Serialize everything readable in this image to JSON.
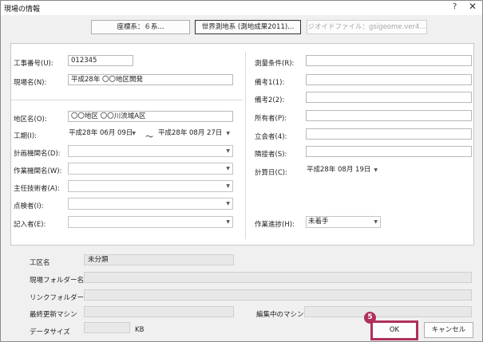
{
  "window": {
    "title": "現場の情報",
    "help": "?",
    "close": "✕"
  },
  "top_buttons": {
    "coord": "座標系：６系...",
    "datum": "世界測地系 (測地成果2011)...",
    "geoid": "ジオイドファイル：gsigeome.ver4..."
  },
  "left": {
    "koji_label": "工事番号(U):",
    "koji_value": "012345",
    "genba_label": "現場名(N):",
    "genba_value": "平成28年 〇〇地区開発",
    "chiku_label": "地区名(O):",
    "chiku_value": "〇〇地区 〇〇川流域A区",
    "kouki_label": "工期(I):",
    "kouki_from": "平成28年 06月 09日",
    "tilde": "～",
    "kouki_to": "平成28年 08月 27日",
    "keikaku_label": "計画機関名(D):",
    "sagyo_label": "作業機関名(W):",
    "shunin_label": "主任技術者(A):",
    "tenken_label": "点検者(I):",
    "kinyu_label": "記入者(E):"
  },
  "right": {
    "sokuryo_label": "測量条件(R):",
    "biko1_label": "備考1(1):",
    "biko2_label": "備考2(2):",
    "shoyu_label": "所有者(P):",
    "tachiai_label": "立会者(4):",
    "rinsetsu_label": "隣接者(S):",
    "keisan_label": "計算日(C):",
    "keisan_value": "平成28年 08月 19日",
    "shincho_label": "作業進捗(H):",
    "shincho_value": "未着手"
  },
  "info": {
    "kouku_label": "工区名",
    "kouku_value": "未分類",
    "folder_label": "現場フォルダー名",
    "link_label": "リンクフォルダー名",
    "machine_label": "最終更新マシン",
    "editing_label": "編集中のマシン",
    "size_label": "データサイズ",
    "size_unit": "KB"
  },
  "buttons": {
    "ok": "OK",
    "cancel": "キャンセル"
  },
  "step_badge": "5",
  "colors": {
    "highlight": "#b0305a"
  }
}
